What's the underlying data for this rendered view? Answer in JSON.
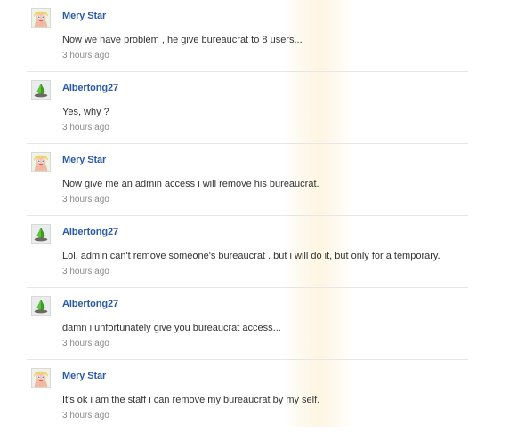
{
  "comments": [
    {
      "user": "Mery Star",
      "avatar": "muppet-avatar-icon",
      "text": "Now we have problem , he give bureaucrat to 8 users...",
      "time": "3 hours ago"
    },
    {
      "user": "Albertong27",
      "avatar": "sims-plumbob-avatar-icon",
      "text": "Yes, why ?",
      "time": "3 hours ago"
    },
    {
      "user": "Mery Star",
      "avatar": "muppet-avatar-icon",
      "text": "Now give me an admin access i will remove his bureaucrat.",
      "time": "3 hours ago"
    },
    {
      "user": "Albertong27",
      "avatar": "sims-plumbob-avatar-icon",
      "text": "Lol, admin can't remove someone's bureaucrat . but i will do it, but only for a temporary.",
      "time": "3 hours ago"
    },
    {
      "user": "Albertong27",
      "avatar": "sims-plumbob-avatar-icon",
      "text": "damn i unfortunately give you bureaucrat access...",
      "time": "3 hours ago"
    },
    {
      "user": "Mery Star",
      "avatar": "muppet-avatar-icon",
      "text": "It's ok i am the staff i can remove my bureaucrat by my self.",
      "time": "3 hours ago"
    }
  ],
  "colors": {
    "username": "#2a5aa8",
    "text": "#333333",
    "timestamp": "#8a8a8a",
    "divider": "#e6e6e6"
  }
}
